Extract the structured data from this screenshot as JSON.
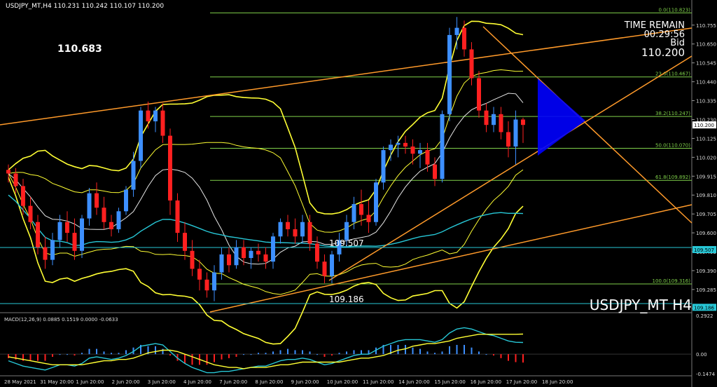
{
  "header": {
    "symbol_info": "USDJPY_MT,H4  110.231 110.242 110.107 110.200"
  },
  "overlay": {
    "high_label": "110.683",
    "time_remain_title": "TIME REMAIN",
    "time_remain": "00:29:56",
    "bid_label": "Bid",
    "bid_value": "110.200",
    "symbol_watermark": "USDJPY_MT H4",
    "label_mid": "109.507",
    "label_low": "109.186"
  },
  "colors": {
    "background": "#000000",
    "bull": "#3d8fff",
    "bear": "#ff2020",
    "bollinger": "#ffff33",
    "channel": "#ff9a2a",
    "fib": "#7fd14a",
    "ma_cyan": "#27c7d6",
    "triangle": "#0000ff"
  },
  "chart_data": [
    {
      "type": "candlestick",
      "title": "USDJPY_MT,H4",
      "y_ticks": [
        "110.755",
        "110.650",
        "110.545",
        "110.440",
        "110.335",
        "110.230",
        "110.125",
        "110.020",
        "109.915",
        "109.810",
        "109.705",
        "109.600",
        "109.495",
        "109.390",
        "109.285",
        "109.180"
      ],
      "ylim": [
        109.16,
        110.84
      ],
      "x_ticks": [
        "28 May 2021",
        "31 May 20:00",
        "1 Jun 20:00",
        "2 Jun 20:00",
        "3 Jun 20:00",
        "4 Jun 20:00",
        "7 Jun 20:00",
        "8 Jun 20:00",
        "9 Jun 20:00",
        "10 Jun 20:00",
        "11 Jun 20:00",
        "14 Jun 20:00",
        "15 Jun 20:00",
        "16 Jun 20:00",
        "17 Jun 20:00",
        "18 Jun 20:00"
      ],
      "fib_levels": [
        {
          "label": "0.0(110.823)",
          "value": 110.823
        },
        {
          "label": "23.6(110.467)",
          "value": 110.467
        },
        {
          "label": "38.2(110.247)",
          "value": 110.247
        },
        {
          "label": "50.0(110.070)",
          "value": 110.07
        },
        {
          "label": "61.8(109.892)",
          "value": 109.892
        },
        {
          "label": "100.0(109.316)",
          "value": 109.316
        }
      ],
      "price_tags": [
        "110.200",
        "109.507",
        "109.186"
      ],
      "candles": [
        [
          109.95,
          109.98,
          109.88,
          109.93
        ],
        [
          109.93,
          109.96,
          109.82,
          109.86
        ],
        [
          109.86,
          109.9,
          109.7,
          109.75
        ],
        [
          109.75,
          109.8,
          109.62,
          109.66
        ],
        [
          109.66,
          109.7,
          109.48,
          109.52
        ],
        [
          109.52,
          109.58,
          109.4,
          109.45
        ],
        [
          109.45,
          109.6,
          109.42,
          109.56
        ],
        [
          109.56,
          109.7,
          109.52,
          109.66
        ],
        [
          109.66,
          109.72,
          109.55,
          109.6
        ],
        [
          109.6,
          109.68,
          109.45,
          109.5
        ],
        [
          109.5,
          109.7,
          109.46,
          109.68
        ],
        [
          109.68,
          109.85,
          109.64,
          109.82
        ],
        [
          109.82,
          109.88,
          109.7,
          109.74
        ],
        [
          109.74,
          109.8,
          109.62,
          109.66
        ],
        [
          109.66,
          109.7,
          109.58,
          109.62
        ],
        [
          109.62,
          109.74,
          109.6,
          109.72
        ],
        [
          109.72,
          109.86,
          109.7,
          109.84
        ],
        [
          109.84,
          110.05,
          109.8,
          110.0
        ],
        [
          110.0,
          110.3,
          109.96,
          110.28
        ],
        [
          110.28,
          110.33,
          110.18,
          110.22
        ],
        [
          110.22,
          110.3,
          110.16,
          110.28
        ],
        [
          110.28,
          110.32,
          110.1,
          110.14
        ],
        [
          110.14,
          110.18,
          109.7,
          109.78
        ],
        [
          109.78,
          109.82,
          109.55,
          109.6
        ],
        [
          109.6,
          109.66,
          109.45,
          109.5
        ],
        [
          109.5,
          109.56,
          109.36,
          109.4
        ],
        [
          109.4,
          109.45,
          109.28,
          109.34
        ],
        [
          109.34,
          109.38,
          109.24,
          109.28
        ],
        [
          109.28,
          109.42,
          109.22,
          109.38
        ],
        [
          109.38,
          109.52,
          109.34,
          109.48
        ],
        [
          109.48,
          109.52,
          109.38,
          109.42
        ],
        [
          109.42,
          109.56,
          109.4,
          109.52
        ],
        [
          109.52,
          109.56,
          109.42,
          109.46
        ],
        [
          109.46,
          109.52,
          109.4,
          109.5
        ],
        [
          109.5,
          109.54,
          109.44,
          109.48
        ],
        [
          109.48,
          109.52,
          109.4,
          109.44
        ],
        [
          109.44,
          109.6,
          109.4,
          109.58
        ],
        [
          109.58,
          109.68,
          109.54,
          109.66
        ],
        [
          109.66,
          109.7,
          109.58,
          109.62
        ],
        [
          109.62,
          109.68,
          109.54,
          109.58
        ],
        [
          109.58,
          109.7,
          109.54,
          109.66
        ],
        [
          109.66,
          109.7,
          109.5,
          109.54
        ],
        [
          109.54,
          109.58,
          109.4,
          109.44
        ],
        [
          109.44,
          109.48,
          109.32,
          109.36
        ],
        [
          109.36,
          109.5,
          109.32,
          109.48
        ],
        [
          109.48,
          109.6,
          109.44,
          109.56
        ],
        [
          109.56,
          109.7,
          109.52,
          109.66
        ],
        [
          109.66,
          109.8,
          109.62,
          109.76
        ],
        [
          109.76,
          109.84,
          109.64,
          109.7
        ],
        [
          109.7,
          109.78,
          109.6,
          109.66
        ],
        [
          109.66,
          109.9,
          109.64,
          109.88
        ],
        [
          109.88,
          110.08,
          109.84,
          110.06
        ],
        [
          110.06,
          110.12,
          110.0,
          110.09
        ],
        [
          110.09,
          110.14,
          110.02,
          110.1
        ],
        [
          110.1,
          110.14,
          110.04,
          110.08
        ],
        [
          110.08,
          110.12,
          109.98,
          110.04
        ],
        [
          110.04,
          110.1,
          109.96,
          110.06
        ],
        [
          110.06,
          110.1,
          109.94,
          109.98
        ],
        [
          109.98,
          110.02,
          109.86,
          109.9
        ],
        [
          109.9,
          110.28,
          109.88,
          110.26
        ],
        [
          110.26,
          110.74,
          110.22,
          110.7
        ],
        [
          110.7,
          110.8,
          110.62,
          110.74
        ],
        [
          110.74,
          110.78,
          110.58,
          110.62
        ],
        [
          110.62,
          110.66,
          110.42,
          110.46
        ],
        [
          110.46,
          110.5,
          110.24,
          110.28
        ],
        [
          110.28,
          110.32,
          110.16,
          110.2
        ],
        [
          110.2,
          110.3,
          110.16,
          110.26
        ],
        [
          110.26,
          110.3,
          110.12,
          110.16
        ],
        [
          110.16,
          110.22,
          110.02,
          110.08
        ],
        [
          110.08,
          110.28,
          109.98,
          110.23
        ],
        [
          110.23,
          110.24,
          110.1,
          110.2
        ]
      ]
    },
    {
      "type": "bar",
      "title": "MACD(12,26,9) 0.0885 0.1519 0.0000 -0.0633",
      "y_ticks": [
        "0.2922",
        "0.00",
        "-0.1474"
      ],
      "ylim": [
        -0.1474,
        0.2922
      ],
      "series": [
        {
          "name": "MACD",
          "values": [
            -0.05,
            -0.07,
            -0.09,
            -0.1,
            -0.11,
            -0.12,
            -0.1,
            -0.08,
            -0.08,
            -0.09,
            -0.07,
            -0.03,
            -0.02,
            -0.03,
            -0.04,
            -0.03,
            -0.01,
            0.02,
            0.06,
            0.07,
            0.08,
            0.07,
            0.02,
            -0.03,
            -0.07,
            -0.1,
            -0.12,
            -0.14,
            -0.14,
            -0.13,
            -0.13,
            -0.12,
            -0.11,
            -0.1,
            -0.09,
            -0.09,
            -0.07,
            -0.05,
            -0.04,
            -0.04,
            -0.03,
            -0.04,
            -0.06,
            -0.08,
            -0.07,
            -0.05,
            -0.03,
            -0.01,
            0.0,
            0.0,
            0.03,
            0.06,
            0.08,
            0.1,
            0.11,
            0.11,
            0.11,
            0.1,
            0.09,
            0.11,
            0.16,
            0.19,
            0.2,
            0.19,
            0.17,
            0.15,
            0.14,
            0.12,
            0.1,
            0.09,
            0.0885
          ]
        },
        {
          "name": "Signal",
          "values": [
            -0.02,
            -0.03,
            -0.04,
            -0.05,
            -0.06,
            -0.07,
            -0.08,
            -0.08,
            -0.08,
            -0.08,
            -0.08,
            -0.07,
            -0.06,
            -0.05,
            -0.05,
            -0.04,
            -0.04,
            -0.03,
            -0.01,
            0.01,
            0.02,
            0.03,
            0.03,
            0.02,
            0.0,
            -0.02,
            -0.04,
            -0.06,
            -0.08,
            -0.09,
            -0.1,
            -0.1,
            -0.11,
            -0.1,
            -0.1,
            -0.1,
            -0.09,
            -0.08,
            -0.08,
            -0.07,
            -0.06,
            -0.06,
            -0.06,
            -0.06,
            -0.06,
            -0.06,
            -0.05,
            -0.04,
            -0.03,
            -0.03,
            -0.02,
            -0.01,
            0.01,
            0.03,
            0.04,
            0.06,
            0.07,
            0.08,
            0.08,
            0.09,
            0.1,
            0.12,
            0.13,
            0.14,
            0.15,
            0.15,
            0.15,
            0.15,
            0.15,
            0.15,
            0.1519
          ]
        },
        {
          "name": "Histogram",
          "values": [
            -0.03,
            -0.04,
            -0.05,
            -0.05,
            -0.05,
            -0.05,
            -0.02,
            0.0,
            0.0,
            -0.01,
            0.01,
            0.04,
            0.04,
            0.02,
            0.01,
            0.01,
            0.03,
            0.05,
            0.07,
            0.06,
            0.06,
            0.04,
            -0.01,
            -0.05,
            -0.07,
            -0.08,
            -0.08,
            -0.08,
            -0.06,
            -0.04,
            -0.03,
            -0.02,
            0.0,
            0.0,
            0.01,
            0.01,
            0.02,
            0.03,
            0.04,
            0.03,
            0.03,
            0.02,
            0.0,
            -0.02,
            -0.01,
            0.01,
            0.02,
            0.03,
            0.03,
            0.03,
            0.05,
            0.07,
            0.07,
            0.07,
            0.07,
            0.05,
            0.04,
            0.02,
            0.01,
            0.02,
            0.06,
            0.07,
            0.07,
            0.05,
            0.02,
            0.0,
            -0.01,
            -0.03,
            -0.05,
            -0.06,
            -0.0633
          ]
        }
      ]
    }
  ]
}
